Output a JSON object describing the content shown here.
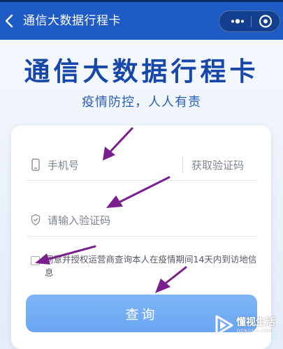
{
  "navbar": {
    "title": "通信大数据行程卡",
    "back_icon": "chevron-left-icon",
    "more_icon": "more-dots-icon",
    "close_icon": "target-circle-icon",
    "color": "#1f5bc4"
  },
  "header": {
    "title": "通信大数据行程卡",
    "subtitle": "疫情防控，人人有责",
    "title_color": "#1747a8"
  },
  "form": {
    "phone": {
      "icon": "phone-icon",
      "placeholder": "手机号",
      "value": ""
    },
    "get_code_label": "获取验证码",
    "code": {
      "icon": "shield-icon",
      "placeholder": "请输入验证码",
      "value": ""
    },
    "agreement": {
      "checked": false,
      "text": "同意并授权运营商查询本人在疫情期间14天内到访地信息"
    },
    "submit_label": "查询",
    "button_color": "#6aa6f2"
  },
  "annotations": {
    "arrow_color": "#7a1f8c",
    "count": 4
  },
  "watermark": {
    "logo": "play-triangle-logo",
    "text": "懂视生活",
    "subtext": "DONGSHI.COM"
  }
}
